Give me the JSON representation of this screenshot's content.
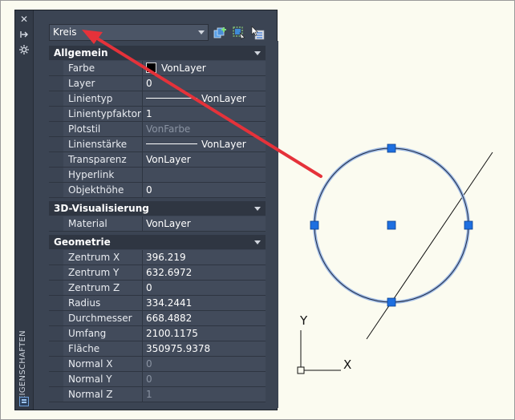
{
  "palette": {
    "vertical_title": "EIGENSCHAFTEN",
    "object_type": "Kreis",
    "sections": [
      {
        "title": "Allgemein",
        "rows": [
          {
            "name": "Farbe",
            "value": "VonLayer"
          },
          {
            "name": "Layer",
            "value": "0"
          },
          {
            "name": "Linientyp",
            "value": "VonLayer"
          },
          {
            "name": "Linientypfaktor",
            "value": "1"
          },
          {
            "name": "Plotstil",
            "value": "VonFarbe"
          },
          {
            "name": "Linienstärke",
            "value": "VonLayer"
          },
          {
            "name": "Transparenz",
            "value": "VonLayer"
          },
          {
            "name": "Hyperlink",
            "value": ""
          },
          {
            "name": "Objekthöhe",
            "value": "0"
          }
        ]
      },
      {
        "title": "3D-Visualisierung",
        "rows": [
          {
            "name": "Material",
            "value": "VonLayer"
          }
        ]
      },
      {
        "title": "Geometrie",
        "rows": [
          {
            "name": "Zentrum X",
            "value": "396.219"
          },
          {
            "name": "Zentrum Y",
            "value": "632.6972"
          },
          {
            "name": "Zentrum Z",
            "value": "0"
          },
          {
            "name": "Radius",
            "value": "334.2441"
          },
          {
            "name": "Durchmesser",
            "value": "668.4882"
          },
          {
            "name": "Umfang",
            "value": "2100.1175"
          },
          {
            "name": "Fläche",
            "value": "350975.9378"
          },
          {
            "name": "Normal X",
            "value": "0"
          },
          {
            "name": "Normal Y",
            "value": "0"
          },
          {
            "name": "Normal Z",
            "value": "1"
          }
        ]
      }
    ]
  },
  "ucs": {
    "x_label": "X",
    "y_label": "Y"
  },
  "colors": {
    "palette_bg": "#3b4453",
    "row_bg": "#424b5b",
    "arrow_red": "#e5323a",
    "circle_blue": "#3b78d8",
    "grip_blue": "#1e6fe0"
  },
  "icons": {
    "strip": [
      "close-icon",
      "autohide-icon",
      "settings-icon"
    ],
    "toolbar": [
      "toggle-pickadd-icon",
      "select-objects-icon",
      "quick-select-icon"
    ]
  }
}
